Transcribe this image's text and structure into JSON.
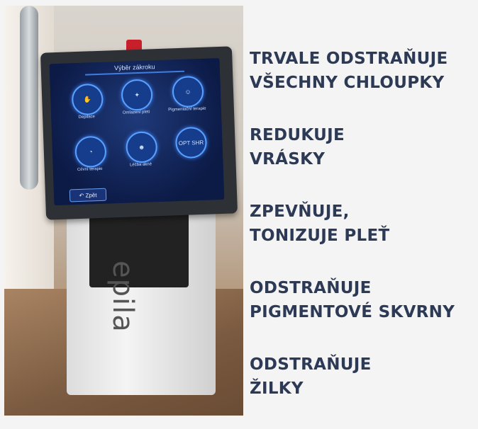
{
  "photo": {
    "screen_title": "Výběr zákroku",
    "icons": [
      {
        "label": "Depilace",
        "glyph": "✋"
      },
      {
        "label": "Omlazení pleti",
        "glyph": "✦"
      },
      {
        "label": "Pigmentační terapie",
        "glyph": "☺"
      },
      {
        "label": "Cévní terapie",
        "glyph": "◔"
      },
      {
        "label": "Léčba akné",
        "glyph": "☻"
      },
      {
        "label": "",
        "glyph": "OPT SHR"
      }
    ],
    "back_label": "Zpět",
    "brand": "epila"
  },
  "claims": [
    {
      "line1": "TRVALE ODSTRAŇUJE",
      "line2": "VŠECHNY CHLOUPKY"
    },
    {
      "line1": "REDUKUJE",
      "line2": "VRÁSKY"
    },
    {
      "line1": "ZPEVŇUJE,",
      "line2": "TONIZUJE PLEŤ"
    },
    {
      "line1": "ODSTRAŇUJE",
      "line2": "PIGMENTOVÉ SKVRNY"
    },
    {
      "line1": "ODSTRAŇUJE",
      "line2": "ŽILKY"
    }
  ]
}
